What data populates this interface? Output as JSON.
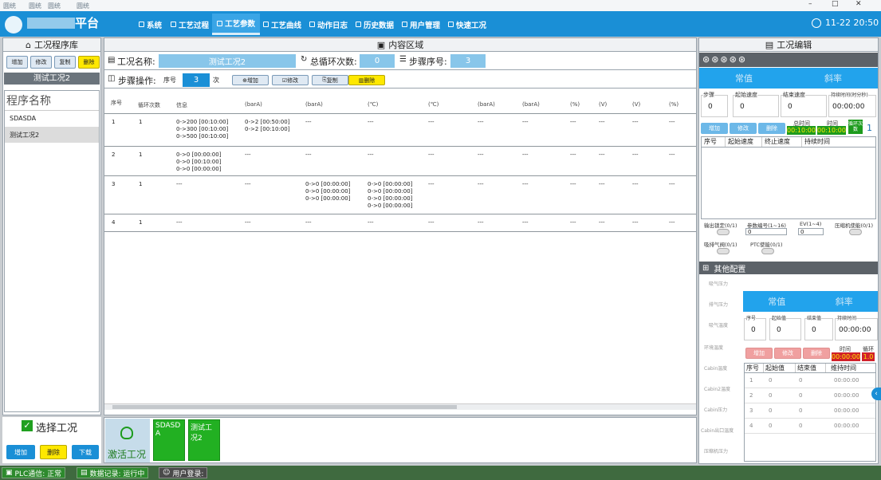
{
  "window": {
    "title_tabs": [
      "圆统",
      "圆统",
      "圆统",
      "圆统"
    ],
    "title_suffix": "平台",
    "controls": [
      "–",
      "□",
      "✕"
    ]
  },
  "nav": {
    "items": [
      "系统",
      "工艺过程",
      "工艺参数",
      "工艺曲线",
      "动作日志",
      "历史数据",
      "用户管理",
      "快速工况"
    ],
    "active": "工艺参数",
    "clock": "11-22 20:50"
  },
  "left_panel": {
    "header": "工况程序库",
    "buttons": [
      "增加",
      "修改",
      "复制",
      "删除"
    ],
    "selected_program": "测试工况2",
    "list_header": "程序名称",
    "programs": [
      "SDASDA",
      "测试工况2"
    ],
    "select_label": "选择工况",
    "bottom_buttons": [
      "增加",
      "删除",
      "下载"
    ]
  },
  "content": {
    "header": "内容区域",
    "name_label": "工况名称:",
    "name_value": "测试工况2",
    "cycles_label": "总循环次数:",
    "cycles_value": "0",
    "step_no_label": "步骤序号:",
    "step_no_value": "3",
    "step_op_label": "步骤操作:",
    "seq_label": "序号",
    "seq_value": "3",
    "times_label": "次",
    "step_buttons": [
      "增加",
      "修改",
      "复制",
      "删除"
    ],
    "columns": [
      "序号",
      "循环次数",
      "信息",
      "(barA)",
      "(barA)",
      "(℃)",
      "(℃)",
      "(barA)",
      "(barA)",
      "(%)",
      "(V)",
      "(V)",
      "(%)"
    ],
    "rows": [
      {
        "seq": "1",
        "cycles": "1",
        "c2": "0->200 [00:10:00]\n0->300 [00:10:00]\n0->500 [00:10:00]",
        "c3": "0->2 [00:50:00]\n0->2 [00:10:00]",
        "c4": "---",
        "c5": "---",
        "rest": [
          "---",
          "---",
          "---",
          "---",
          "---",
          "---",
          "---"
        ]
      },
      {
        "seq": "2",
        "cycles": "1",
        "c2": "0->0 [00:00:00]\n0->0 [00:10:00]\n0->0 [00:00:00]",
        "c3": "---",
        "c4": "---",
        "c5": "---",
        "rest": [
          "---",
          "---",
          "---",
          "---",
          "---",
          "---",
          "---"
        ]
      },
      {
        "seq": "3",
        "cycles": "1",
        "c2": "---",
        "c3": "---",
        "c4": "0->0 [00:00:00]\n0->0 [00:00:00]\n0->0 [00:00:00]",
        "c5": "0->0 [00:00:00]\n0->0 [00:00:00]\n0->0 [00:00:00]\n0->0 [00:00:00]",
        "rest": [
          "---",
          "---",
          "---",
          "---",
          "---",
          "---",
          "---"
        ]
      },
      {
        "seq": "4",
        "cycles": "1",
        "c2": "---",
        "c3": "---",
        "c4": "---",
        "c5": "---",
        "rest": [
          "---",
          "---",
          "---",
          "---",
          "---",
          "---",
          "---"
        ]
      }
    ],
    "activate_label": "激活工况",
    "recipe_cards": [
      "SDASDA",
      "测试工况2"
    ]
  },
  "right_panel": {
    "header": "工况编辑",
    "mode_tabs": [
      "常值",
      "斜率"
    ],
    "param_labels": [
      "步骤",
      "起始速度",
      "结束速度",
      "持续时间(时分秒)"
    ],
    "param_values": [
      "0",
      "0",
      "0",
      "00:00:00"
    ],
    "action_buttons": [
      "增加",
      "修改",
      "删除"
    ],
    "total_time_label": "总时间",
    "total_time": "00:10:00",
    "time_label": "时间",
    "time_value": "00:10:00",
    "cycle_label": "循环次数",
    "cycle_value": "1",
    "table_columns": [
      "序号",
      "起始速度",
      "终止速度",
      "持续时间"
    ],
    "io": [
      "输出锁定(0/1)",
      "参数编号(1~16)",
      "EV(1~4)",
      "压缩机使能(0/1)",
      "吸排气阀(0/1)",
      "PTC使能(0/1)"
    ],
    "io_values": [
      "0",
      "0"
    ],
    "other_header": "其他配置",
    "other_labels": [
      "吸气压力",
      "排气压力",
      "吸气温度",
      "环境温度",
      "Cabin温度",
      "Cabin2温度",
      "Cabin压力",
      "Cabin出口温度",
      "压缩机压力"
    ],
    "other_mode_tabs": [
      "常值",
      "斜率"
    ],
    "other_param_labels": [
      "序号",
      "起始值",
      "结束值",
      "持续时间"
    ],
    "other_param_values": [
      "0",
      "0",
      "0",
      "00:00:00"
    ],
    "other_action_buttons": [
      "增加",
      "修改",
      "删除"
    ],
    "other_time_label": "时间",
    "other_time": "00:00:00",
    "other_cycle_label": "循环",
    "other_cycle": "1.0",
    "other_table_columns": [
      "序号",
      "起始值",
      "结束值",
      "维持时间"
    ],
    "other_rows": [
      [
        "1",
        "0",
        "0",
        "00:00:00"
      ],
      [
        "2",
        "0",
        "0",
        "00:00:00"
      ],
      [
        "3",
        "0",
        "0",
        "00:00:00"
      ],
      [
        "4",
        "0",
        "0",
        "00:00:00"
      ]
    ]
  },
  "status": {
    "plc": "PLC通信: 正常",
    "record": "数据记录: 运行中",
    "user": "用户登录:"
  }
}
